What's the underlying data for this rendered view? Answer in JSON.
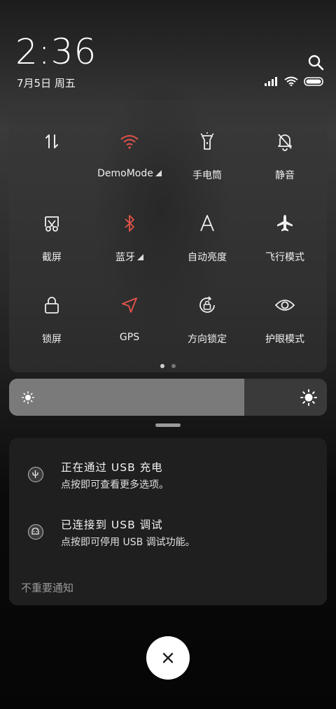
{
  "clock": {
    "time": "2:36",
    "date": "7月5日 周五"
  },
  "tiles": [
    {
      "label": "",
      "icon": "data-arrows-icon",
      "active": false,
      "has_menu": false
    },
    {
      "label": "DemoMode",
      "icon": "wifi-icon",
      "active": true,
      "has_menu": true
    },
    {
      "label": "手电筒",
      "icon": "flashlight-icon",
      "active": false,
      "has_menu": false
    },
    {
      "label": "静音",
      "icon": "bell-off-icon",
      "active": false,
      "has_menu": false
    },
    {
      "label": "截屏",
      "icon": "screenshot-icon",
      "active": false,
      "has_menu": false
    },
    {
      "label": "蓝牙",
      "icon": "bluetooth-icon",
      "active": true,
      "has_menu": true
    },
    {
      "label": "自动亮度",
      "icon": "auto-brightness-icon",
      "active": false,
      "has_menu": false
    },
    {
      "label": "飞行模式",
      "icon": "airplane-icon",
      "active": false,
      "has_menu": false
    },
    {
      "label": "锁屏",
      "icon": "lock-icon",
      "active": false,
      "has_menu": false
    },
    {
      "label": "GPS",
      "icon": "location-arrow-icon",
      "active": true,
      "has_menu": false
    },
    {
      "label": "方向锁定",
      "icon": "rotation-lock-icon",
      "active": false,
      "has_menu": false
    },
    {
      "label": "护眼模式",
      "icon": "eye-icon",
      "active": false,
      "has_menu": false
    }
  ],
  "accent_color": "#e5534b",
  "brightness": {
    "level": 0.74
  },
  "notifications": [
    {
      "title": "正在通过 USB 充电",
      "subtitle": "点按即可查看更多选项。",
      "icon": "usb-icon"
    },
    {
      "title": "已连接到 USB 调试",
      "subtitle": "点按即可停用 USB 调试功能。",
      "icon": "android-icon"
    }
  ],
  "minor_notifications_label": "不重要通知"
}
